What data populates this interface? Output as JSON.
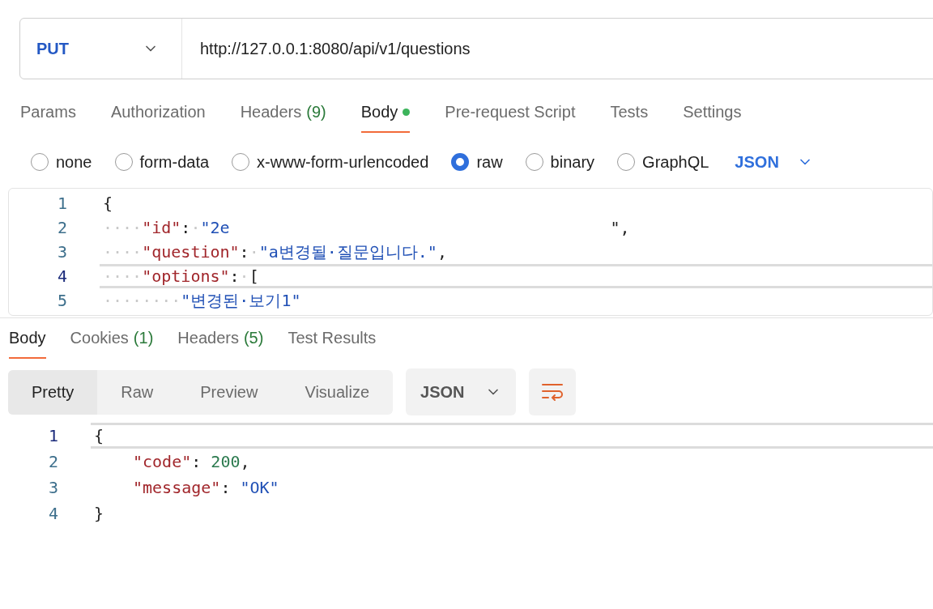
{
  "request": {
    "method": "PUT",
    "url": "http://127.0.0.1:8080/api/v1/questions"
  },
  "request_tabs": [
    {
      "label": "Params",
      "selected": false
    },
    {
      "label": "Authorization",
      "selected": false
    },
    {
      "label": "Headers",
      "count": "(9)",
      "selected": false
    },
    {
      "label": "Body",
      "dot": true,
      "selected": true
    },
    {
      "label": "Pre-request Script",
      "selected": false
    },
    {
      "label": "Tests",
      "selected": false
    },
    {
      "label": "Settings",
      "selected": false
    }
  ],
  "body_types": [
    {
      "label": "none",
      "selected": false
    },
    {
      "label": "form-data",
      "selected": false
    },
    {
      "label": "x-www-form-urlencoded",
      "selected": false
    },
    {
      "label": "raw",
      "selected": true
    },
    {
      "label": "binary",
      "selected": false
    },
    {
      "label": "GraphQL",
      "selected": false
    }
  ],
  "body_format": "JSON",
  "request_editor": [
    {
      "number": "1",
      "active": false,
      "tokens": [
        {
          "kind": "punct",
          "text": "{"
        }
      ]
    },
    {
      "number": "2",
      "active": false,
      "tokens": [
        {
          "kind": "ws",
          "text": "····"
        },
        {
          "kind": "key",
          "text": "\"id\""
        },
        {
          "kind": "punct",
          "text": ":"
        },
        {
          "kind": "ws",
          "text": "·"
        },
        {
          "kind": "string",
          "text": "\"2e"
        },
        {
          "kind": "redacted"
        },
        {
          "kind": "punct",
          "text": "\","
        }
      ]
    },
    {
      "number": "3",
      "active": false,
      "tokens": [
        {
          "kind": "ws",
          "text": "····"
        },
        {
          "kind": "key",
          "text": "\"question\""
        },
        {
          "kind": "punct",
          "text": ":"
        },
        {
          "kind": "ws",
          "text": "·"
        },
        {
          "kind": "string",
          "text": "\"a변경될·질문입니다.\""
        },
        {
          "kind": "punct",
          "text": ","
        }
      ]
    },
    {
      "number": "4",
      "active": true,
      "tokens": [
        {
          "kind": "ws",
          "text": "····"
        },
        {
          "kind": "key",
          "text": "\"options\""
        },
        {
          "kind": "punct",
          "text": ":"
        },
        {
          "kind": "ws",
          "text": "·"
        },
        {
          "kind": "punct",
          "text": "["
        }
      ]
    },
    {
      "number": "5",
      "active": false,
      "tokens": [
        {
          "kind": "ws",
          "text": "········"
        },
        {
          "kind": "string",
          "text": "\"변경된·보기1\""
        }
      ]
    }
  ],
  "response_tabs": [
    {
      "label": "Body",
      "selected": true
    },
    {
      "label": "Cookies",
      "count": "(1)",
      "selected": false
    },
    {
      "label": "Headers",
      "count": "(5)",
      "selected": false
    },
    {
      "label": "Test Results",
      "selected": false
    }
  ],
  "view_modes": [
    {
      "label": "Pretty",
      "selected": true
    },
    {
      "label": "Raw",
      "selected": false
    },
    {
      "label": "Preview",
      "selected": false
    },
    {
      "label": "Visualize",
      "selected": false
    }
  ],
  "response_format": "JSON",
  "response_editor": [
    {
      "number": "1",
      "active": true,
      "tokens": [
        {
          "kind": "punct",
          "text": "{"
        }
      ]
    },
    {
      "number": "2",
      "active": false,
      "indent": true,
      "tokens": [
        {
          "kind": "key",
          "text": "\"code\""
        },
        {
          "kind": "punct",
          "text": ": "
        },
        {
          "kind": "number",
          "text": "200"
        },
        {
          "kind": "punct",
          "text": ","
        }
      ]
    },
    {
      "number": "3",
      "active": false,
      "indent": true,
      "tokens": [
        {
          "kind": "key",
          "text": "\"message\""
        },
        {
          "kind": "punct",
          "text": ": "
        },
        {
          "kind": "string",
          "text": "\"OK\""
        }
      ]
    },
    {
      "number": "4",
      "active": false,
      "tokens": [
        {
          "kind": "punct",
          "text": "}"
        }
      ]
    }
  ]
}
